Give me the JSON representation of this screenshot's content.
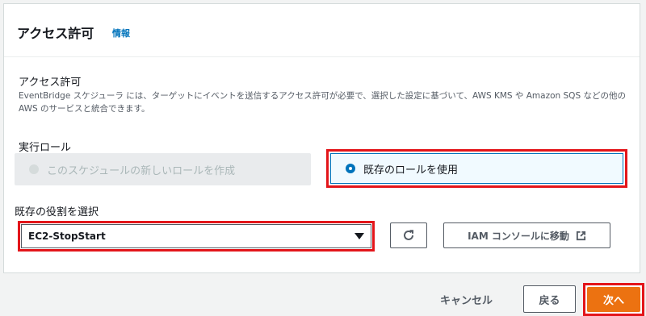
{
  "panel": {
    "title": "アクセス許可",
    "info_link": "情報"
  },
  "permissions": {
    "label": "アクセス許可",
    "description": "EventBridge スケジューラ には、ターゲットにイベントを送信するアクセス許可が必要で、選択した設定に基づいて、AWS KMS や Amazon SQS などの他の AWS のサービスと統合できます。"
  },
  "execution_role": {
    "label": "実行ロール",
    "options": [
      {
        "label": "このスケジュールの新しいロールを作成",
        "selected": false,
        "disabled": true
      },
      {
        "label": "既存のロールを使用",
        "selected": true,
        "disabled": false
      }
    ]
  },
  "existing_role": {
    "label": "既存の役割を選択",
    "selected_value": "EC2-StopStart",
    "iam_button_label": "IAM コンソールに移動"
  },
  "footer": {
    "cancel_label": "キャンセル",
    "back_label": "戻る",
    "next_label": "次へ"
  },
  "colors": {
    "highlight": "#e3151a",
    "primary": "#ec7211",
    "link": "#0073bb"
  },
  "icons": {
    "refresh": "refresh-icon",
    "external": "external-link-icon",
    "caret": "caret-down-icon"
  }
}
